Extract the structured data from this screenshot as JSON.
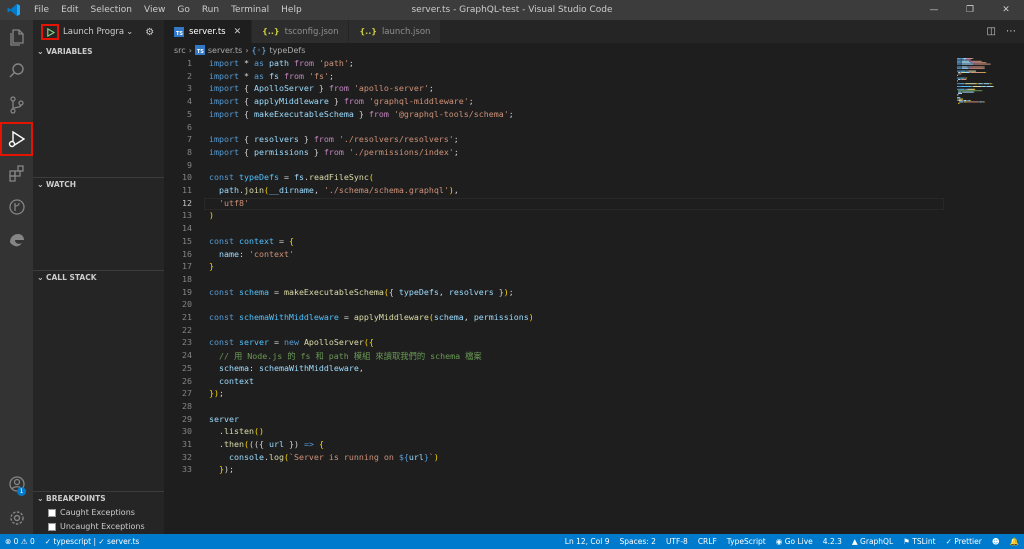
{
  "window": {
    "title": "server.ts - GraphQL-test - Visual Studio Code",
    "menu": [
      "File",
      "Edit",
      "Selection",
      "View",
      "Go",
      "Run",
      "Terminal",
      "Help"
    ]
  },
  "debug": {
    "config_label": "Launch Progra",
    "sections": {
      "variables": "VARIABLES",
      "watch": "WATCH",
      "call_stack": "CALL STACK",
      "breakpoints": "BREAKPOINTS"
    },
    "breakpoints": [
      "Caught Exceptions",
      "Uncaught Exceptions"
    ]
  },
  "account_badge": "1",
  "tabs": [
    {
      "label": "server.ts",
      "icon": "typescript-file-icon",
      "active": true
    },
    {
      "label": "tsconfig.json",
      "icon": "json-file-icon",
      "active": false
    },
    {
      "label": "launch.json",
      "icon": "json-file-icon",
      "active": false
    }
  ],
  "breadcrumb": [
    "src",
    "server.ts",
    "typeDefs"
  ],
  "editor": {
    "current_line": 12,
    "lines": [
      [
        [
          "k",
          "import "
        ],
        [
          "p",
          "* "
        ],
        [
          "k",
          "as "
        ],
        [
          "v",
          "path "
        ],
        [
          "ki",
          "from "
        ],
        [
          "s",
          "'path'"
        ],
        [
          "p",
          ";"
        ]
      ],
      [
        [
          "k",
          "import "
        ],
        [
          "p",
          "* "
        ],
        [
          "k",
          "as "
        ],
        [
          "v",
          "fs "
        ],
        [
          "ki",
          "from "
        ],
        [
          "s",
          "'fs'"
        ],
        [
          "p",
          ";"
        ]
      ],
      [
        [
          "k",
          "import "
        ],
        [
          "p",
          "{ "
        ],
        [
          "v",
          "ApolloServer "
        ],
        [
          "p",
          "} "
        ],
        [
          "ki",
          "from "
        ],
        [
          "s",
          "'apollo-server'"
        ],
        [
          "p",
          ";"
        ]
      ],
      [
        [
          "k",
          "import "
        ],
        [
          "p",
          "{ "
        ],
        [
          "v",
          "applyMiddleware "
        ],
        [
          "p",
          "} "
        ],
        [
          "ki",
          "from "
        ],
        [
          "s",
          "'graphql-middleware'"
        ],
        [
          "p",
          ";"
        ]
      ],
      [
        [
          "k",
          "import "
        ],
        [
          "p",
          "{ "
        ],
        [
          "v",
          "makeExecutableSchema "
        ],
        [
          "p",
          "} "
        ],
        [
          "ki",
          "from "
        ],
        [
          "s",
          "'@graphql-tools/schema'"
        ],
        [
          "p",
          ";"
        ]
      ],
      [],
      [
        [
          "k",
          "import "
        ],
        [
          "p",
          "{ "
        ],
        [
          "v",
          "resolvers "
        ],
        [
          "p",
          "} "
        ],
        [
          "ki",
          "from "
        ],
        [
          "s",
          "'./resolvers/resolvers'"
        ],
        [
          "p",
          ";"
        ]
      ],
      [
        [
          "k",
          "import "
        ],
        [
          "p",
          "{ "
        ],
        [
          "v",
          "permissions "
        ],
        [
          "p",
          "} "
        ],
        [
          "ki",
          "from "
        ],
        [
          "s",
          "'./permissions/index'"
        ],
        [
          "p",
          ";"
        ]
      ],
      [],
      [
        [
          "k",
          "const "
        ],
        [
          "cn",
          "typeDefs "
        ],
        [
          "p",
          "= "
        ],
        [
          "v",
          "fs"
        ],
        [
          "p",
          "."
        ],
        [
          "f",
          "readFileSync"
        ],
        [
          "br",
          "("
        ]
      ],
      [
        [
          "p",
          "  "
        ],
        [
          "v",
          "path"
        ],
        [
          "p",
          "."
        ],
        [
          "f",
          "join"
        ],
        [
          "br",
          "("
        ],
        [
          "v",
          "__dirname"
        ],
        [
          "p",
          ", "
        ],
        [
          "s",
          "'./schema/schema.graphql'"
        ],
        [
          "br",
          ")"
        ],
        [
          "p",
          ","
        ]
      ],
      [
        [
          "p",
          "  "
        ],
        [
          "s",
          "'utf8'"
        ]
      ],
      [
        [
          "br",
          ")"
        ]
      ],
      [],
      [
        [
          "k",
          "const "
        ],
        [
          "cn",
          "context "
        ],
        [
          "p",
          "= "
        ],
        [
          "br",
          "{"
        ]
      ],
      [
        [
          "p",
          "  "
        ],
        [
          "v",
          "name"
        ],
        [
          "p",
          ": "
        ],
        [
          "s",
          "'context'"
        ]
      ],
      [
        [
          "br",
          "}"
        ]
      ],
      [],
      [
        [
          "k",
          "const "
        ],
        [
          "cn",
          "schema "
        ],
        [
          "p",
          "= "
        ],
        [
          "f",
          "makeExecutableSchema"
        ],
        [
          "br",
          "("
        ],
        [
          "p",
          "{ "
        ],
        [
          "v",
          "typeDefs"
        ],
        [
          "p",
          ", "
        ],
        [
          "v",
          "resolvers "
        ],
        [
          "p",
          "}"
        ],
        [
          "br",
          ")"
        ],
        [
          "p",
          ";"
        ]
      ],
      [],
      [
        [
          "k",
          "const "
        ],
        [
          "cn",
          "schemaWithMiddleware "
        ],
        [
          "p",
          "= "
        ],
        [
          "f",
          "applyMiddleware"
        ],
        [
          "br",
          "("
        ],
        [
          "v",
          "schema"
        ],
        [
          "p",
          ", "
        ],
        [
          "v",
          "permissions"
        ],
        [
          "br",
          ")"
        ]
      ],
      [],
      [
        [
          "k",
          "const "
        ],
        [
          "cn",
          "server "
        ],
        [
          "p",
          "= "
        ],
        [
          "k",
          "new "
        ],
        [
          "f",
          "ApolloServer"
        ],
        [
          "br",
          "({"
        ]
      ],
      [
        [
          "p",
          "  "
        ],
        [
          "c",
          "// 用 Node.js 的 fs 和 path 模組 來讀取我們的 schema 檔案"
        ]
      ],
      [
        [
          "p",
          "  "
        ],
        [
          "v",
          "schema"
        ],
        [
          "p",
          ": "
        ],
        [
          "v",
          "schemaWithMiddleware"
        ],
        [
          "p",
          ","
        ]
      ],
      [
        [
          "p",
          "  "
        ],
        [
          "v",
          "context"
        ]
      ],
      [
        [
          "br",
          "})"
        ],
        [
          "p",
          ";"
        ]
      ],
      [],
      [
        [
          "v",
          "server"
        ]
      ],
      [
        [
          "p",
          "  ."
        ],
        [
          "f",
          "listen"
        ],
        [
          "br",
          "()"
        ]
      ],
      [
        [
          "p",
          "  ."
        ],
        [
          "f",
          "then"
        ],
        [
          "br",
          "("
        ],
        [
          "p",
          "(({ "
        ],
        [
          "v",
          "url "
        ],
        [
          "p",
          "}) "
        ],
        [
          "k",
          "=> "
        ],
        [
          "br",
          "{"
        ]
      ],
      [
        [
          "p",
          "    "
        ],
        [
          "v",
          "console"
        ],
        [
          "p",
          "."
        ],
        [
          "f",
          "log"
        ],
        [
          "br",
          "("
        ],
        [
          "s",
          "`Server is running on "
        ],
        [
          "k",
          "${"
        ],
        [
          "v",
          "url"
        ],
        [
          "k",
          "}"
        ],
        [
          "s",
          "`"
        ],
        [
          "br",
          ")"
        ]
      ],
      [
        [
          "p",
          "  "
        ],
        [
          "br",
          "}"
        ],
        [
          "p",
          ");"
        ]
      ]
    ]
  },
  "status": {
    "errors": "0",
    "warnings": "0",
    "language_mode": "typescript",
    "file": "server.ts",
    "position": "Ln 12, Col 9",
    "spaces": "Spaces: 2",
    "encoding": "UTF-8",
    "eol": "CRLF",
    "language": "TypeScript",
    "go_live": "Go Live",
    "version": "4.2.3",
    "graphql": "GraphQL",
    "tslint": "TSLint",
    "prettier": "Prettier"
  }
}
